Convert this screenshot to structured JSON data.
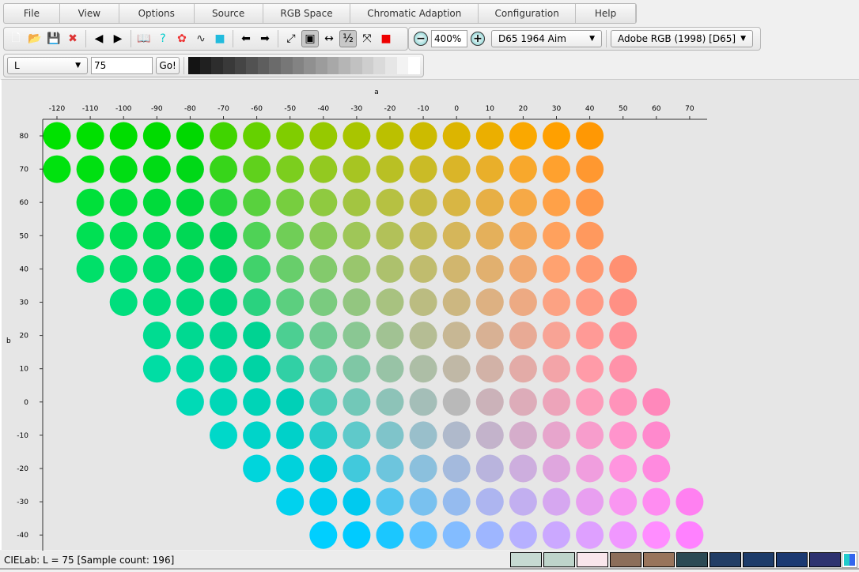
{
  "menu": [
    "File",
    "View",
    "Options",
    "Source",
    "RGB Space",
    "Chromatic Adaption",
    "Configuration",
    "Help"
  ],
  "toolbar": {
    "icons": [
      "new-file-icon",
      "open-folder-icon",
      "save-icon",
      "close-file-icon",
      "import-icon",
      "export-icon",
      "book-icon",
      "help-icon",
      "color-wheel-icon",
      "curve-icon",
      "palette-icon",
      "arrow-left-icon",
      "arrow-right-icon",
      "swap-axes-icon",
      "size-icon",
      "fit-width-icon",
      "half-icon",
      "fullscreen-icon",
      "color-compare-icon"
    ],
    "zoom": "400%",
    "illuminant": "D65 1964 Aim",
    "rgb_space": "Adobe RGB (1998) [D65]"
  },
  "row2": {
    "channel": "L",
    "value": "75",
    "go": "Go!",
    "gray_steps": 20
  },
  "chart_data": {
    "type": "scatter",
    "xlabel": "a",
    "ylabel": "b",
    "L": 75,
    "x_ticks": [
      -120,
      -110,
      -100,
      -90,
      -80,
      -70,
      -60,
      -50,
      -40,
      -30,
      -20,
      -10,
      0,
      10,
      20,
      30,
      40,
      50,
      60,
      70
    ],
    "y_ticks": [
      80,
      70,
      60,
      50,
      40,
      30,
      20,
      10,
      0,
      -10,
      -20,
      -30,
      -40
    ],
    "rows": [
      {
        "b": 80,
        "a": [
          -120,
          40
        ]
      },
      {
        "b": 70,
        "a": [
          -120,
          40
        ]
      },
      {
        "b": 60,
        "a": [
          -110,
          40
        ]
      },
      {
        "b": 50,
        "a": [
          -110,
          40
        ]
      },
      {
        "b": 40,
        "a": [
          -110,
          50
        ]
      },
      {
        "b": 30,
        "a": [
          -100,
          50
        ]
      },
      {
        "b": 20,
        "a": [
          -90,
          50
        ]
      },
      {
        "b": 10,
        "a": [
          -90,
          50
        ]
      },
      {
        "b": 0,
        "a": [
          -80,
          60
        ]
      },
      {
        "b": -10,
        "a": [
          -70,
          60
        ]
      },
      {
        "b": -20,
        "a": [
          -60,
          60
        ]
      },
      {
        "b": -30,
        "a": [
          -50,
          70
        ]
      },
      {
        "b": -40,
        "a": [
          -40,
          70
        ]
      }
    ]
  },
  "status": {
    "text": "CIELab: L = 75  [Sample count: 196]",
    "swatches": [
      "#c6dad2",
      "#bed4ca",
      "#f9e6ec",
      "#8c6e5a",
      "#98745c",
      "#2c4a54",
      "#223e66",
      "#1e3c6a",
      "#1c3a72",
      "#2e3270"
    ]
  }
}
